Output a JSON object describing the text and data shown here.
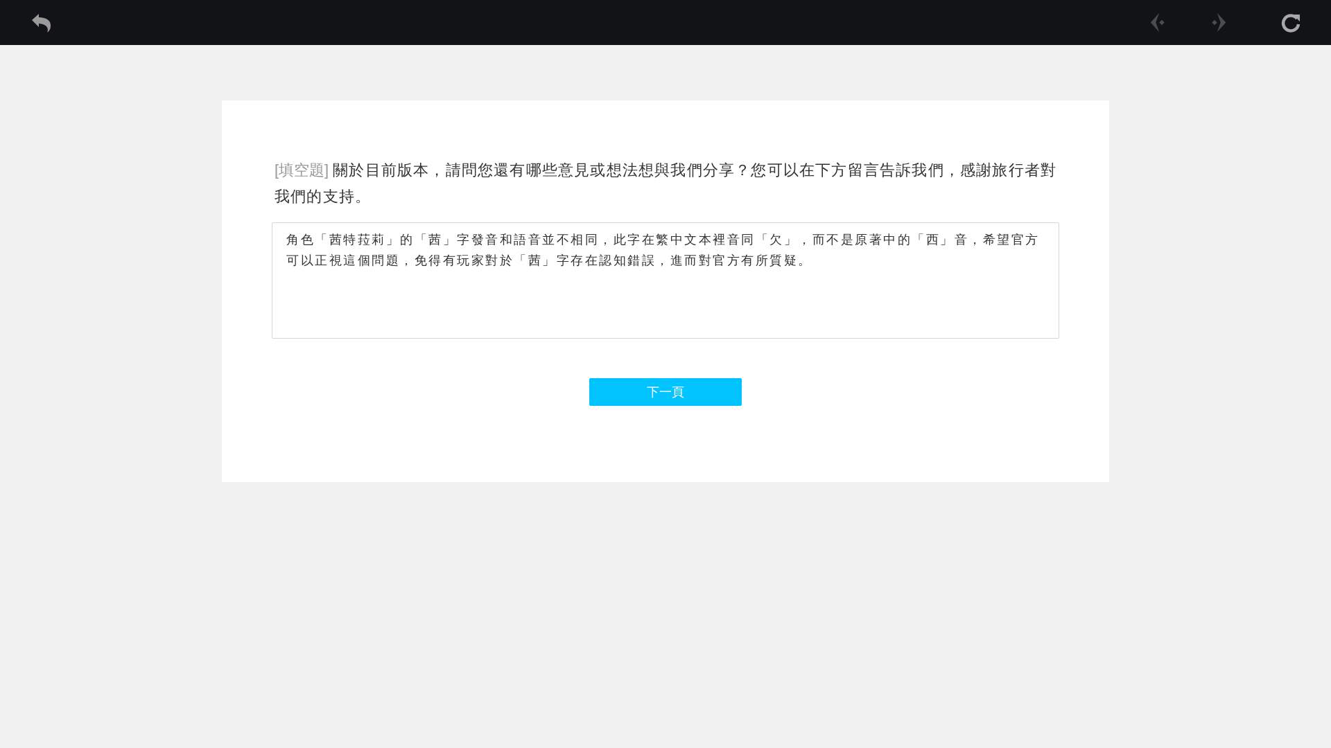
{
  "toolbar": {
    "prev": {
      "disabled": true
    },
    "next": {
      "disabled": true
    }
  },
  "question": {
    "type_tag": "[填空題]",
    "text": "關於目前版本，請問您還有哪些意見或想法想與我們分享？您可以在下方留言告訴我們，感謝旅行者對我們的支持。"
  },
  "answer": {
    "value": "角色「茜特菈莉」的「茜」字發音和語音並不相同，此字在繁中文本裡音同「欠」，而不是原著中的「西」音，希望官方可以正視這個問題，免得有玩家對於「茜」字存在認知錯誤，進而對官方有所質疑。"
  },
  "buttons": [
    {
      "label": "下一頁"
    }
  ]
}
